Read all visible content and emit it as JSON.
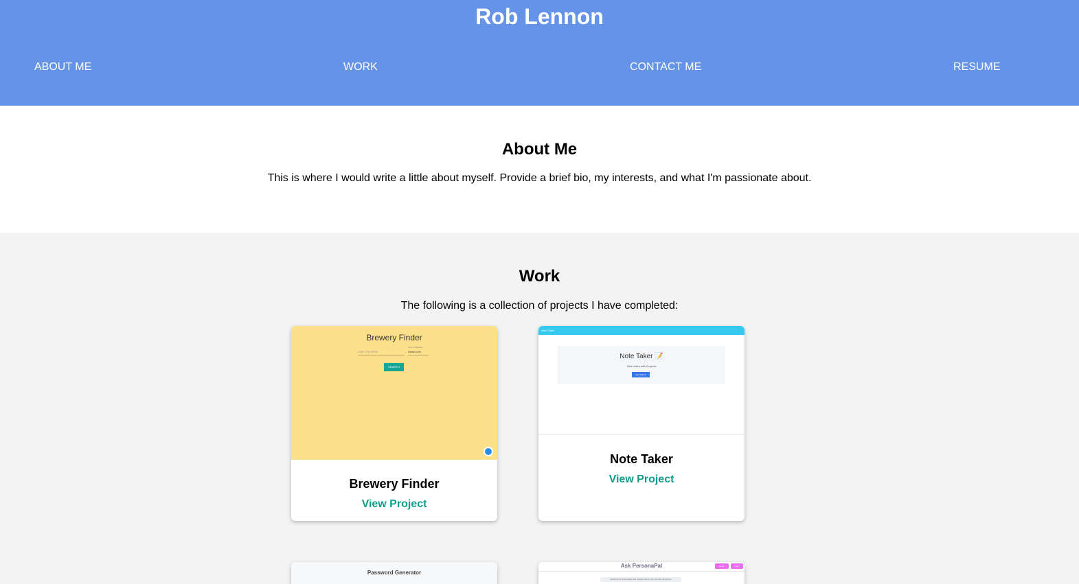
{
  "header": {
    "title": "Rob Lennon",
    "nav": [
      {
        "label": "ABOUT ME"
      },
      {
        "label": "WORK"
      },
      {
        "label": "CONTACT ME"
      },
      {
        "label": "RESUME"
      }
    ]
  },
  "about": {
    "heading": "About Me",
    "text": "This is where I would write a little about myself. Provide a brief bio, my interests, and what I'm passionate about."
  },
  "work": {
    "heading": "Work",
    "intro": "The following is a collection of projects I have completed:",
    "projects": [
      {
        "title": "Brewery Finder",
        "link": "View Project",
        "screenshot": {
          "title": "Brewery Finder",
          "input_placeholder": "Enter City Name",
          "select_label": "Type of Brewery",
          "select_value": "Select one",
          "button": "SEARCH"
        }
      },
      {
        "title": "Note Taker",
        "link": "View Project",
        "screenshot": {
          "bar": "Note Taker",
          "title": "Note Taker 📝",
          "subtitle": "Take notes with Express",
          "button": "Get Started"
        }
      },
      {
        "title": "",
        "link": "",
        "screenshot": {
          "title": "Password Generator"
        }
      },
      {
        "title": "",
        "link": "",
        "screenshot": {
          "title": "Ask PersonaPal",
          "button1": "Home",
          "button2": "Login",
          "message": "Welcome to PersonaPal, the website where you can ask questions!"
        }
      }
    ]
  },
  "colors": {
    "header_bg": "#6593e8",
    "link": "#0f9d8a",
    "work_bg": "#f3f3f3"
  }
}
